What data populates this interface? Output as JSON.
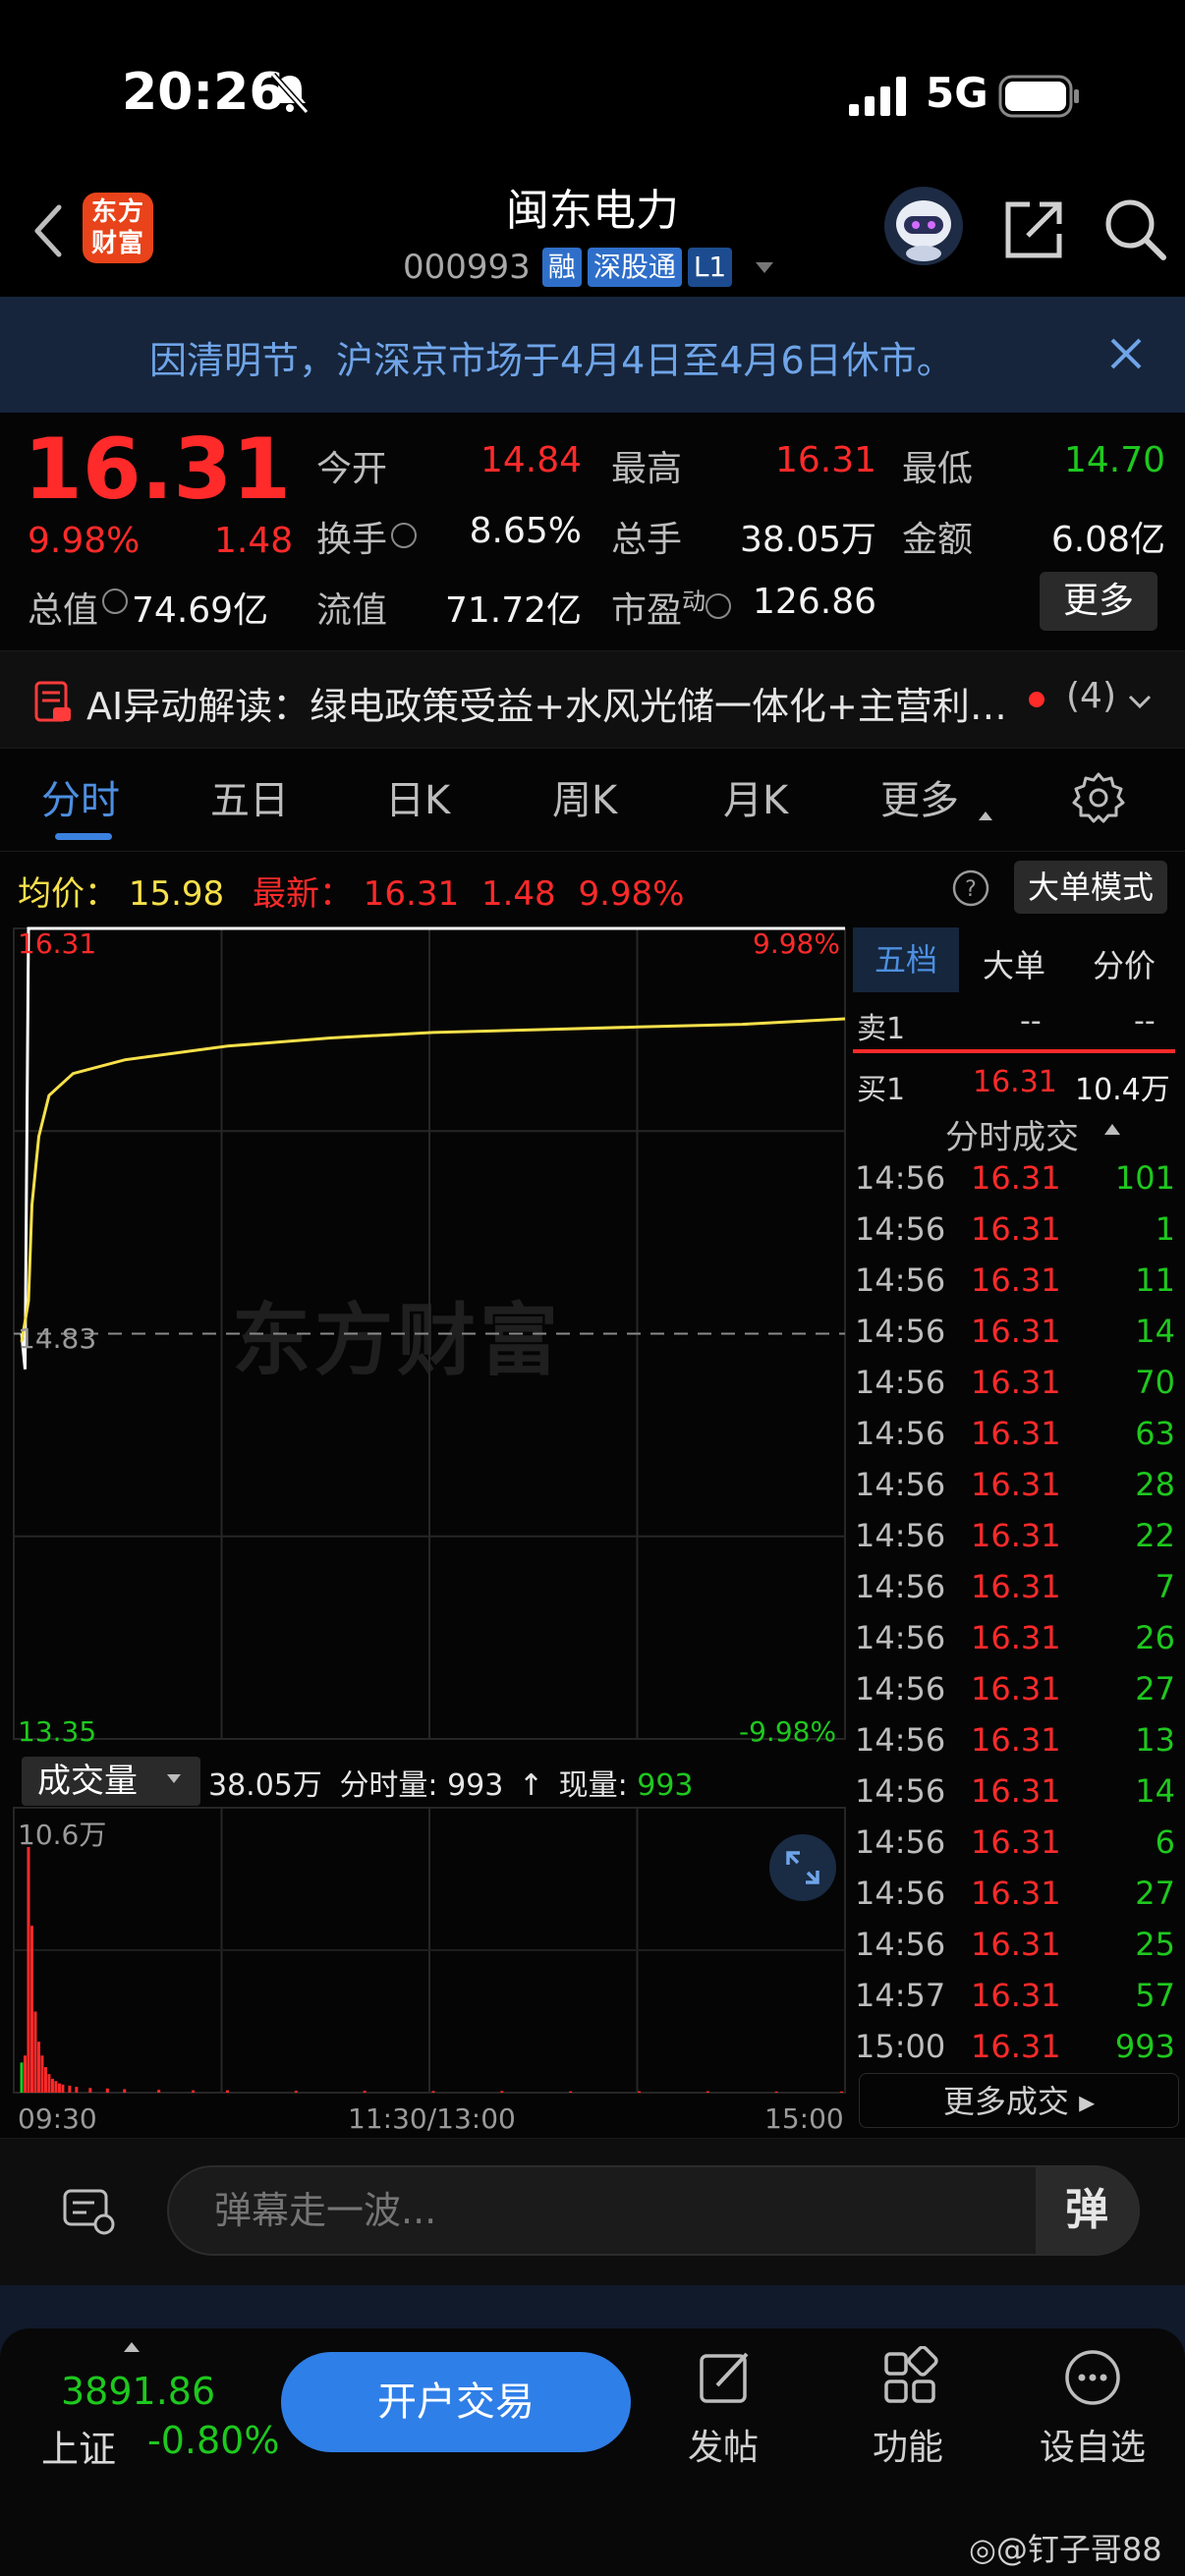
{
  "status": {
    "time": "20:26",
    "network": "5G"
  },
  "header": {
    "logo_line1": "东方",
    "logo_line2": "财富",
    "stock_name": "闽东电力",
    "stock_code": "000993",
    "tags": [
      "融",
      "深股通",
      "L1"
    ]
  },
  "notice": {
    "text": "因清明节，沪深京市场于4月4日至4月6日休市。"
  },
  "quote": {
    "price": "16.31",
    "change_pct": "9.98%",
    "change": "1.48",
    "open_label": "今开",
    "open": "14.84",
    "high_label": "最高",
    "high": "16.31",
    "low_label": "最低",
    "low": "14.70",
    "turnover_label": "换手",
    "turnover": "8.65%",
    "volume_label": "总手",
    "volume": "38.05万",
    "amount_label": "金额",
    "amount": "6.08亿",
    "total_value_label": "总值",
    "total_value": "74.69亿",
    "float_value_label": "流值",
    "float_value": "71.72亿",
    "pe_label": "市盈",
    "pe_sup": "动",
    "pe": "126.86",
    "more_label": "更多"
  },
  "ai_bar": {
    "text": "AI异动解读：绿电政策受益+水风光储一体化+主营利…",
    "count": "(4)"
  },
  "tabs": [
    "分时",
    "五日",
    "日K",
    "周K",
    "月K",
    "更多"
  ],
  "info_line": {
    "avg_label": "均价：",
    "avg": "15.98",
    "latest_label": "最新：",
    "latest": "16.31",
    "latest_chg": "1.48",
    "latest_pct": "9.98%",
    "mode_label": "大单模式"
  },
  "chart_data": {
    "type": "line",
    "title": "",
    "price_axis": {
      "top": "16.31",
      "mid": "14.83",
      "bottom": "13.35",
      "top_pct": "9.98%",
      "bottom_pct": "-9.98%"
    },
    "x_labels": [
      "09:30",
      "11:30/13:00",
      "15:00"
    ],
    "ylim": [
      13.35,
      16.31
    ],
    "price_series": [
      [
        0,
        14.83
      ],
      [
        1,
        14.7
      ],
      [
        2,
        16.31
      ],
      [
        3,
        16.31
      ],
      [
        4,
        16.31
      ],
      [
        5,
        16.31
      ],
      [
        10,
        16.31
      ],
      [
        30,
        16.31
      ],
      [
        60,
        16.31
      ],
      [
        120,
        16.31
      ],
      [
        180,
        16.31
      ],
      [
        240,
        16.31
      ]
    ],
    "avg_series": [
      [
        0,
        14.8
      ],
      [
        2,
        14.95
      ],
      [
        3,
        15.3
      ],
      [
        5,
        15.55
      ],
      [
        8,
        15.7
      ],
      [
        15,
        15.78
      ],
      [
        30,
        15.83
      ],
      [
        60,
        15.88
      ],
      [
        90,
        15.91
      ],
      [
        120,
        15.93
      ],
      [
        150,
        15.94
      ],
      [
        180,
        15.95
      ],
      [
        210,
        15.96
      ],
      [
        240,
        15.98
      ]
    ],
    "volume": {
      "label": "成交量",
      "total": "38.05万",
      "minute_label": "分时量:",
      "minute_value": "993",
      "current_label": "现量:",
      "current_value": "993",
      "max_label": "10.6万",
      "ylim": [
        0,
        10.6
      ],
      "bars": [
        [
          0,
          1.3,
          "green"
        ],
        [
          1,
          1.6,
          "red"
        ],
        [
          2,
          10.6,
          "red"
        ],
        [
          3,
          7.2,
          "red"
        ],
        [
          4,
          3.5,
          "red"
        ],
        [
          5,
          2.2,
          "red"
        ],
        [
          6,
          1.6,
          "red"
        ],
        [
          7,
          1.1,
          "red"
        ],
        [
          8,
          0.8,
          "red"
        ],
        [
          9,
          0.6,
          "red"
        ],
        [
          10,
          0.5,
          "red"
        ],
        [
          11,
          0.4,
          "red"
        ],
        [
          12,
          0.35,
          "red"
        ],
        [
          14,
          0.3,
          "red"
        ],
        [
          16,
          0.25,
          "red"
        ],
        [
          20,
          0.2,
          "red"
        ],
        [
          25,
          0.18,
          "red"
        ],
        [
          30,
          0.15,
          "red"
        ],
        [
          40,
          0.12,
          "red"
        ],
        [
          50,
          0.1,
          "red"
        ],
        [
          60,
          0.1,
          "red"
        ],
        [
          80,
          0.08,
          "red"
        ],
        [
          100,
          0.08,
          "red"
        ],
        [
          120,
          0.07,
          "red"
        ],
        [
          140,
          0.07,
          "red"
        ],
        [
          160,
          0.06,
          "red"
        ],
        [
          180,
          0.06,
          "red"
        ],
        [
          200,
          0.06,
          "red"
        ],
        [
          220,
          0.05,
          "red"
        ],
        [
          239,
          0.05,
          "red"
        ]
      ]
    }
  },
  "watermark": "东方财富",
  "right_panel": {
    "tabs": [
      "五档",
      "大单",
      "分价"
    ],
    "sell1": {
      "label": "卖1",
      "price": "--",
      "vol": "--"
    },
    "buy1": {
      "label": "买1",
      "price": "16.31",
      "vol": "10.4万"
    },
    "ticks_title": "分时成交",
    "ticks": [
      {
        "t": "14:56",
        "p": "16.31",
        "v": "101"
      },
      {
        "t": "14:56",
        "p": "16.31",
        "v": "1"
      },
      {
        "t": "14:56",
        "p": "16.31",
        "v": "11"
      },
      {
        "t": "14:56",
        "p": "16.31",
        "v": "14"
      },
      {
        "t": "14:56",
        "p": "16.31",
        "v": "70"
      },
      {
        "t": "14:56",
        "p": "16.31",
        "v": "63"
      },
      {
        "t": "14:56",
        "p": "16.31",
        "v": "28"
      },
      {
        "t": "14:56",
        "p": "16.31",
        "v": "22"
      },
      {
        "t": "14:56",
        "p": "16.31",
        "v": "7"
      },
      {
        "t": "14:56",
        "p": "16.31",
        "v": "26"
      },
      {
        "t": "14:56",
        "p": "16.31",
        "v": "27"
      },
      {
        "t": "14:56",
        "p": "16.31",
        "v": "13"
      },
      {
        "t": "14:56",
        "p": "16.31",
        "v": "14"
      },
      {
        "t": "14:56",
        "p": "16.31",
        "v": "6"
      },
      {
        "t": "14:56",
        "p": "16.31",
        "v": "27"
      },
      {
        "t": "14:56",
        "p": "16.31",
        "v": "25"
      },
      {
        "t": "14:57",
        "p": "16.31",
        "v": "57"
      },
      {
        "t": "15:00",
        "p": "16.31",
        "v": "993"
      }
    ],
    "more_trades": "更多成交"
  },
  "comment_bar": {
    "placeholder": "弹幕走一波...",
    "danmu_label": "弹"
  },
  "bottom_bar": {
    "index_value": "3891.86",
    "index_name": "上证",
    "index_pct": "-0.80%",
    "trade_button": "开户交易",
    "post_label": "发帖",
    "function_label": "功能",
    "watchlist_label": "设自选"
  },
  "credit": "@钉子哥88",
  "colors": {
    "up": "#ff2a2a",
    "down": "#1ec81e",
    "price_line": "#ffffff",
    "avg_line": "#f7e04a",
    "accent": "#3b82e0"
  }
}
